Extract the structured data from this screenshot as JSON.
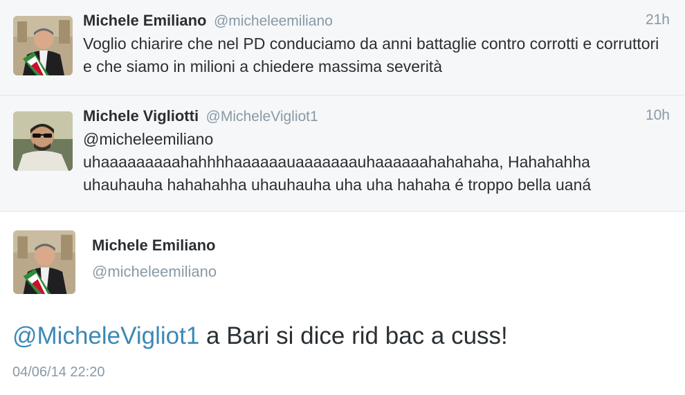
{
  "tweets": [
    {
      "name": "Michele Emiliano",
      "handle": "@micheleemiliano",
      "time": "21h",
      "text": "Voglio chiarire che nel PD conduciamo da anni battaglie contro corrotti e corruttori e che siamo in milioni a chiedere massima severità"
    },
    {
      "name": "Michele Vigliotti",
      "handle": "@MicheleVigliot1",
      "time": "10h",
      "text_lines": [
        "@micheleemiliano",
        "uhaaaaaaaaahahhhhaaaaaauaaaaaaauhaaaaaahahahaha, Hahahahha",
        "uhauhauha hahahahha uhauhauha uha uha hahaha é troppo bella uaná"
      ]
    }
  ],
  "detail": {
    "name": "Michele Emiliano",
    "handle": "@micheleemiliano",
    "mention": "@MicheleVigliot1",
    "text": " a Bari si dice rid bac a cuss!",
    "date": "04/06/14 22:20"
  },
  "icons": {
    "avatar_emiliano": "profile-photo-man-with-tricolor-sash",
    "avatar_vigliotti": "profile-photo-man-with-sunglasses"
  },
  "colors": {
    "name": "#292f33",
    "secondary": "#8899a6",
    "mention": "#3b88b8",
    "list_bg": "#f6f7f8",
    "detail_bg": "#ffffff"
  }
}
